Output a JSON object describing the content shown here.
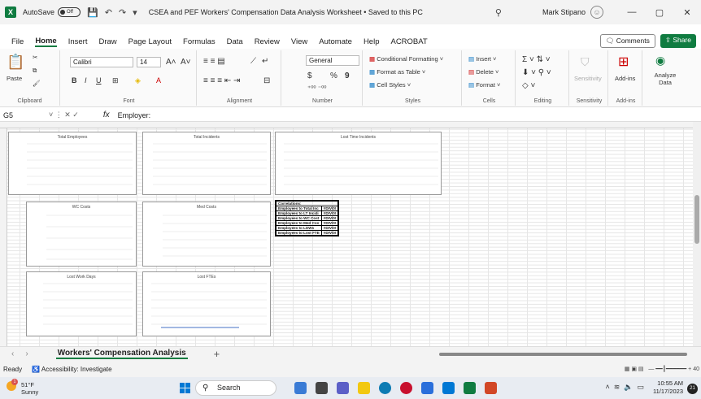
{
  "window": {
    "autosave_label": "AutoSave",
    "autosave_state": "Off",
    "document_title": "CSEA and PEF Workers' Compensation Data Analysis Worksheet • Saved to this PC",
    "user_name": "Mark Stipano",
    "minimize": "—",
    "restore": "▢",
    "close": "✕"
  },
  "menu": {
    "tabs": [
      "File",
      "Home",
      "Insert",
      "Draw",
      "Page Layout",
      "Formulas",
      "Data",
      "Review",
      "View",
      "Automate",
      "Help",
      "ACROBAT"
    ],
    "comments_label": "Comments",
    "share_label": "Share"
  },
  "ribbon": {
    "clipboard": {
      "label": "Clipboard",
      "paste": "Paste"
    },
    "font": {
      "label": "Font",
      "name": "Calibri",
      "size": "14",
      "bold": "B",
      "italic": "I",
      "underline": "U"
    },
    "alignment": {
      "label": "Alignment"
    },
    "number": {
      "label": "Number",
      "format": "General",
      "currency": "$",
      "percent": "%",
      "comma": "9"
    },
    "styles": {
      "label": "Styles",
      "conditional": "Conditional Formatting",
      "format_table": "Format as Table",
      "cell_styles": "Cell Styles"
    },
    "cells": {
      "label": "Cells",
      "insert": "Insert",
      "delete": "Delete",
      "format": "Format"
    },
    "editing": {
      "label": "Editing"
    },
    "sensitivity": {
      "label": "Sensitivity",
      "button": "Sensitivity"
    },
    "addins": {
      "label": "Add-ins",
      "button": "Add-ins"
    },
    "analyze": {
      "button": "Analyze Data"
    }
  },
  "formula_bar": {
    "cell_ref": "G5",
    "fx": "fx",
    "content": "Employer:"
  },
  "charts": {
    "total_employees": "Total Employees",
    "total_incidents": "Total Incidents",
    "lost_time_incidents": "Lost Time Incidents",
    "wc_costs": "WC Costs",
    "med_costs": "Med Costs",
    "lost_work_days": "Lost Work Days",
    "lost_ftes": "Lost FTEs"
  },
  "correlations": {
    "header": "Correlations:",
    "rows": [
      {
        "label": "Employees to Total Inc",
        "value": "#DIV/0!"
      },
      {
        "label": "Employees to LT Incidi",
        "value": "#DIV/0!"
      },
      {
        "label": "Employees to WC Cost",
        "value": "#DIV/0!"
      },
      {
        "label": "Employees to Med Cos",
        "value": "#DIV/0!"
      },
      {
        "label": "Employees to LDWs",
        "value": "#DIV/0!"
      },
      {
        "label": "Employees to Lost FTE",
        "value": "#DIV/0!"
      }
    ]
  },
  "sheet_tabs": {
    "active": "Workers' Compensation Analysis",
    "add": "+"
  },
  "status": {
    "ready": "Ready",
    "accessibility": "Accessibility: Investigate",
    "zoom": "40"
  },
  "taskbar": {
    "temp": "51°F",
    "condition": "Sunny",
    "badge": "1",
    "search": "Search",
    "time": "10:55 AM",
    "date": "11/17/2023",
    "notifications": "21"
  },
  "colors": {
    "accent": "#107c41",
    "chart_line": "#4472c4"
  }
}
